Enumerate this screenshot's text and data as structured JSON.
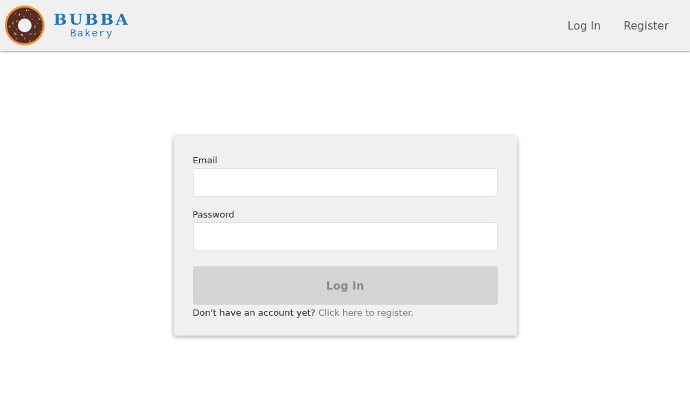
{
  "header": {
    "logo": {
      "title": "BUBBA",
      "subtitle": "Bakery"
    },
    "nav": [
      {
        "label": "Log In"
      },
      {
        "label": "Register"
      }
    ]
  },
  "form": {
    "fields": [
      {
        "label": "Email"
      },
      {
        "label": "Password"
      }
    ],
    "submit": {
      "label": "Log In",
      "disabled": true
    },
    "footer": {
      "prompt": "Don't have an account yet?",
      "link": "Click here to register."
    }
  }
}
